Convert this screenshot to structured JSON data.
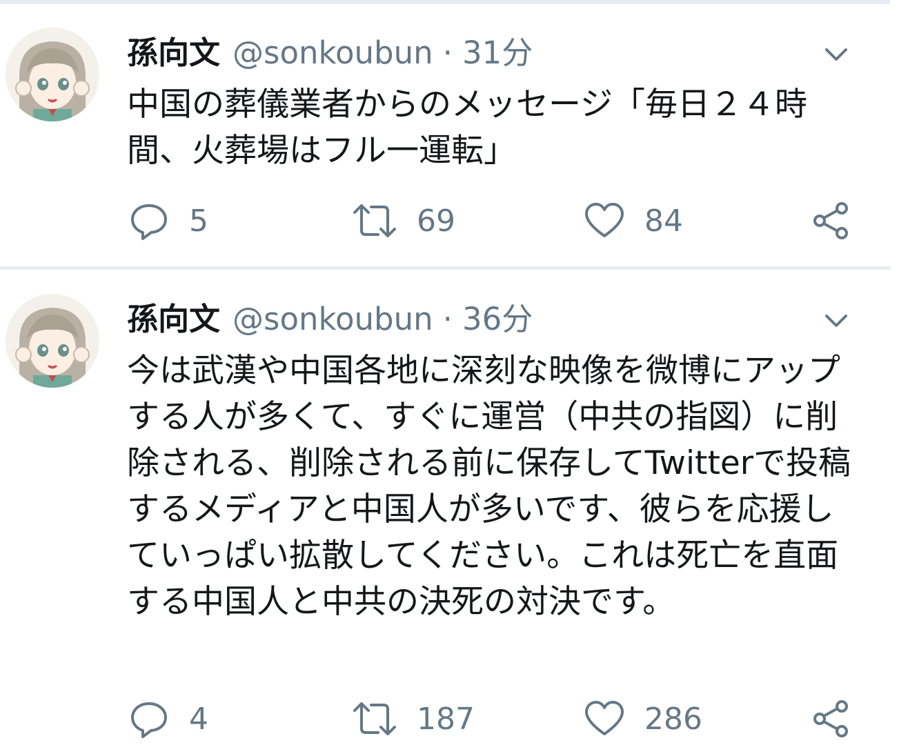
{
  "tweets": [
    {
      "display_name": "孫向文",
      "handle": "@sonkoubun",
      "separator": "·",
      "time": "31分",
      "text": "中国の葬儀業者からのメッセージ「毎日２４時間、火葬場はフル一運転」",
      "reply_count": "5",
      "retweet_count": "69",
      "like_count": "84"
    },
    {
      "display_name": "孫向文",
      "handle": "@sonkoubun",
      "separator": "·",
      "time": "36分",
      "text": "今は武漢や中国各地に深刻な映像を微博にアップする人が多くて、すぐに運営（中共の指図）に削除される、削除される前に保存してTwitterで投稿するメディアと中国人が多いです、彼らを応援していっぱい拡散してください。これは死亡を直面する中国人と中共の決死の対決です。",
      "reply_count": "4",
      "retweet_count": "187",
      "like_count": "286"
    }
  ],
  "colors": {
    "text": "#14171a",
    "secondary": "#657786",
    "divider": "#e6ecf0"
  },
  "icons": [
    "reply-icon",
    "retweet-icon",
    "like-icon",
    "share-icon",
    "chevron-down-icon"
  ]
}
